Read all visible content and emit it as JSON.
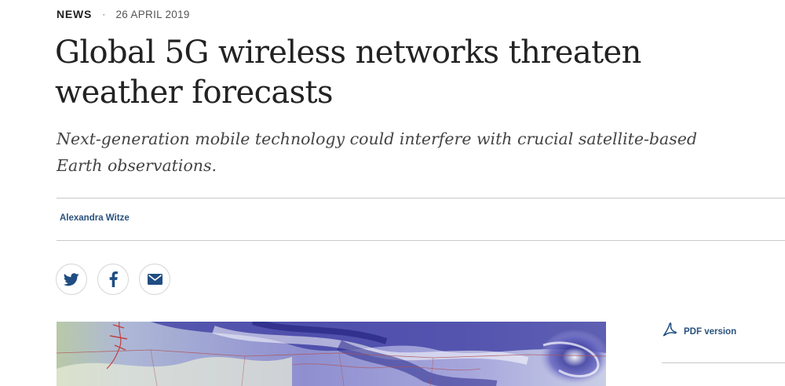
{
  "article": {
    "type": "NEWS",
    "separator": "·",
    "date": "26 APRIL 2019",
    "title": "Global 5G wireless networks threaten weather forecasts",
    "standfirst": "Next-generation mobile technology could interfere with crucial satellite-based Earth observations.",
    "author": "Alexandra Witze"
  },
  "share": {
    "buttons": [
      {
        "icon": "twitter-icon",
        "label": "Share on Twitter"
      },
      {
        "icon": "facebook-icon",
        "label": "Share on Facebook"
      },
      {
        "icon": "email-icon",
        "label": "Share via E-Mail"
      }
    ]
  },
  "sidebar": {
    "pdf_label": "PDF version",
    "pdf_icon": "acrobat-icon"
  },
  "figure": {
    "description_icon": "weather-satellite-image"
  },
  "colors": {
    "link": "#29517d",
    "text": "#222222",
    "rule": "#c8c8c8",
    "share_icon": "#1f4d82"
  }
}
